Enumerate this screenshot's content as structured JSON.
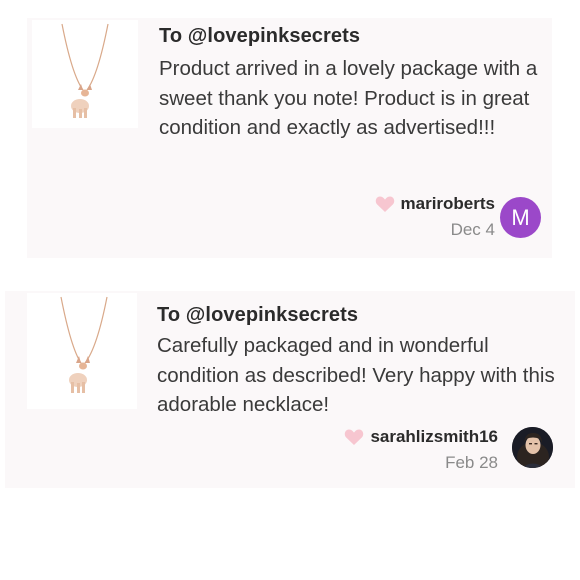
{
  "reviews": [
    {
      "to": "To @lovepinksecrets",
      "text": "Product arrived in a lovely package with a sweet thank you note! Product is in great condition and exactly as advertised!!!",
      "username": "mariroberts",
      "date": "Dec 4",
      "avatar_initial": "M",
      "avatar_color": "#9b48c9"
    },
    {
      "to": "To @lovepinksecrets",
      "text": "Carefully packaged and in wonderful condition as described! Very happy with this adorable necklace!",
      "username": "sarahlizsmith16",
      "date": "Feb 28"
    }
  ],
  "colors": {
    "card_bg": "#fbf8f9",
    "heart": "#f7c6d0",
    "necklace_gold": "#d9a98a"
  },
  "icons": {
    "heart": "heart-icon",
    "product": "necklace-thumbnail"
  }
}
